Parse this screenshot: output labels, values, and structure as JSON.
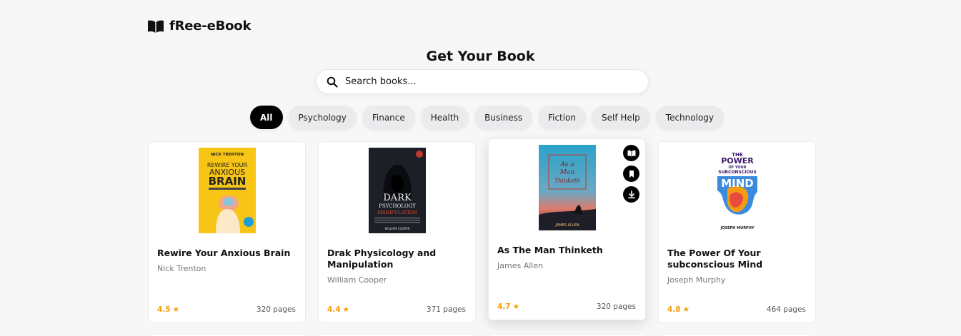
{
  "brand": {
    "name": "fRee-eBook",
    "icon": "open-book-icon"
  },
  "page_title": "Get Your Book",
  "search": {
    "placeholder": "Search books...",
    "icon": "search-icon"
  },
  "categories": [
    "All",
    "Psychology",
    "Finance",
    "Health",
    "Business",
    "Fiction",
    "Self Help",
    "Technology"
  ],
  "active_category": "All",
  "books": [
    {
      "title": "Rewire Your Anxious Brain",
      "author": "Nick Trenton",
      "rating": "4.5",
      "pages": "320 pages",
      "cover": {
        "top": "NICK TRENTON",
        "line1": "REWIRE YOUR",
        "line2": "ANXIOUS",
        "line3": "BRAIN",
        "color": "#f7c515"
      }
    },
    {
      "title": "Drak Physicology and Manipulation",
      "author": "William Cooper",
      "rating": "4.4",
      "pages": "371 pages",
      "cover": {
        "line1": "DARK",
        "line2": "PSYCHOLOGY",
        "line3": "MANIPULATION",
        "bottom": "WILLIAM COOPER",
        "color": "#1c1f26"
      }
    },
    {
      "title": "As The Man Thinketh",
      "author": "James Allen",
      "rating": "4.7",
      "pages": "320 pages",
      "cover": {
        "line1": "As a",
        "line2": "Man",
        "line3": "Thinketh",
        "bottom": "JAMES ALLEN",
        "color": "#2ba3c9"
      },
      "actions": [
        "read-icon",
        "bookmark-icon",
        "download-icon"
      ]
    },
    {
      "title": "The Power Of Your subconscious Mind",
      "author": "Joseph Murphy",
      "rating": "4.8",
      "pages": "464 pages",
      "cover": {
        "line1": "THE",
        "line2": "POWER",
        "line3": "OF YOUR",
        "line4": "SUBCONSCIOUS",
        "line5": "MIND",
        "bottom": "JOSEPH MURPHY",
        "color": "#ffffff"
      }
    }
  ],
  "colors": {
    "accent": "#000000",
    "rating": "#f59e0b",
    "chip": "#ebebee",
    "background": "#f7f7f8"
  }
}
